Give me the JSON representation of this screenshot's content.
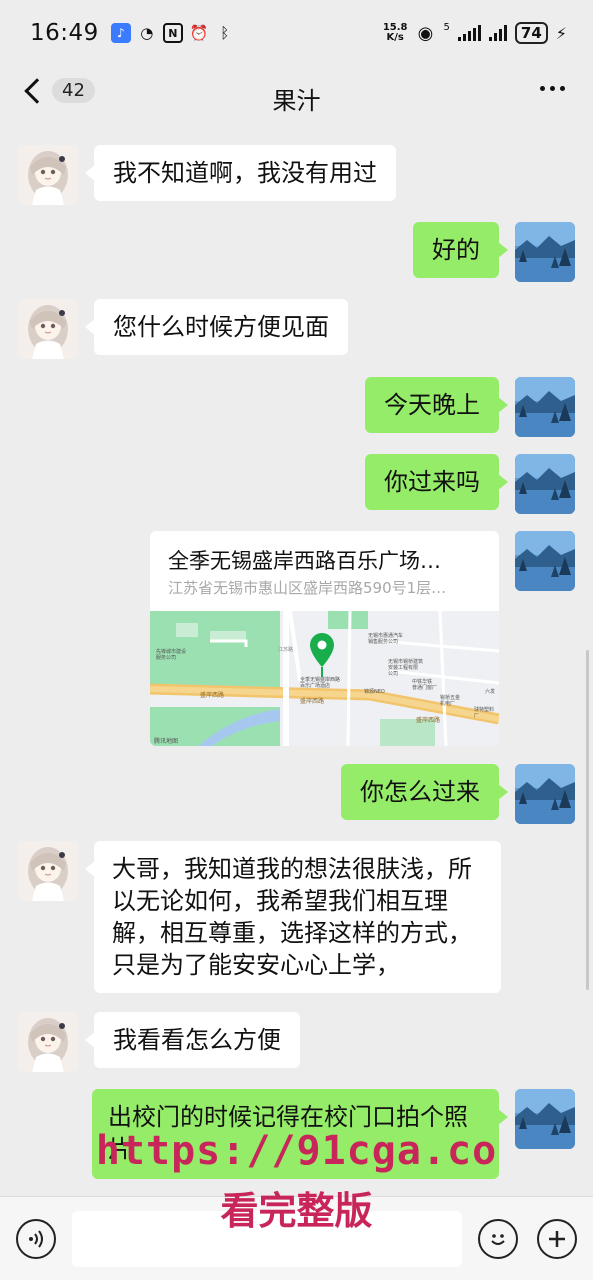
{
  "status_bar": {
    "time": "16:49",
    "net_speed_value": "15.8",
    "net_speed_unit": "K/s",
    "signal_label": "5",
    "battery": "74"
  },
  "header": {
    "unread_count": "42",
    "title": "果汁"
  },
  "messages": [
    {
      "side": "in",
      "text": "我不知道啊，我没有用过"
    },
    {
      "side": "out",
      "text": "好的"
    },
    {
      "side": "in",
      "text": "您什么时候方便见面"
    },
    {
      "side": "out",
      "text": "今天晚上"
    },
    {
      "side": "out",
      "text": "你过来吗"
    },
    {
      "side": "out",
      "type": "location"
    },
    {
      "side": "out",
      "text": "你怎么过来"
    },
    {
      "side": "in",
      "text": "大哥，我知道我的想法很肤浅，所\n以无论如何，我希望我们相互理\n解，相互尊重，选择这样的方式，\n只是为了能安安心心上学，"
    },
    {
      "side": "in",
      "text": "我看看怎么方便"
    },
    {
      "side": "out",
      "text": "出校门的时候记得在校门口拍个照\n片"
    }
  ],
  "location": {
    "title": "全季无锡盛岸西路百乐广场…",
    "address": "江苏省无锡市惠山区盛岸西路590号1层…",
    "map_labels": {
      "poi_1": "无锡市惠通汽车\n销售服务公司",
      "poi_2": "无锡市锡桥建筑\n安装工程有限\n公司",
      "poi_3": "中铁华铁\n普通门窗厂",
      "poi_4": "全季无锡盛岸西路\n百乐广场酒店",
      "poi_5": "锦源NEO",
      "poi_6": "锡桥五金\n机电厂",
      "poi_7": "先锋城市建设\n服务公司",
      "poi_8": "球特塑料\n厂",
      "poi_9": "六发",
      "road_1": "盛岸西路",
      "road_2": "盛岸西路",
      "road_3": "盛岸西路",
      "road_4": "江苏路",
      "attribution": "腾讯地图"
    }
  },
  "input_bar": {
    "placeholder": ""
  },
  "watermark": {
    "url": "https://91cga.co",
    "text": "看完整版"
  },
  "colors": {
    "background": "#ededed",
    "outgoing_bubble": "#95ec69",
    "incoming_bubble": "#ffffff",
    "map_pin": "#1aad4b",
    "watermark": "#c8265a"
  }
}
